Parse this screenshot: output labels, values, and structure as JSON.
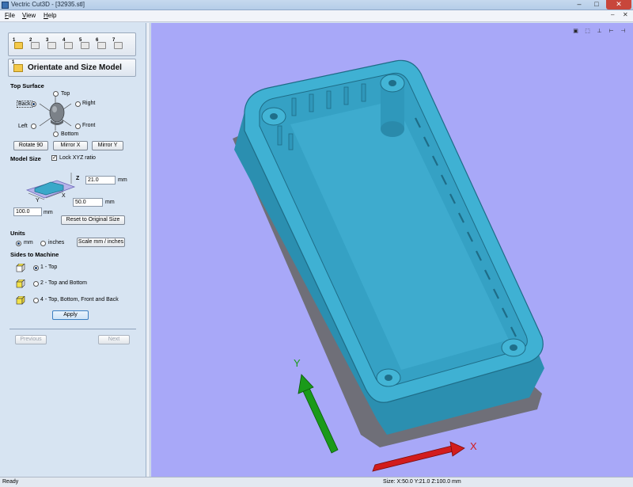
{
  "window": {
    "title": "Vectric Cut3D - [32935.stl]",
    "minimize_glyph": "–",
    "maximize_glyph": "□",
    "close_glyph": "✕"
  },
  "menu": {
    "items": [
      "File",
      "View",
      "Help"
    ],
    "mdi_minimize": "–",
    "mdi_close": "✕"
  },
  "steps": [
    {
      "number": "1",
      "icon": "folder-open-icon"
    },
    {
      "number": "2",
      "icon": "orientate-icon"
    },
    {
      "number": "3",
      "icon": "material-icon"
    },
    {
      "number": "4",
      "icon": "roughing-icon"
    },
    {
      "number": "5",
      "icon": "finishing-icon"
    },
    {
      "number": "6",
      "icon": "cutout-icon"
    },
    {
      "number": "7",
      "icon": "save-toolpath-icon"
    }
  ],
  "panel": {
    "heading_number": "1",
    "heading": "Orientate and Size Model",
    "top_surface": {
      "label": "Top Surface",
      "top": "Top",
      "back": "Back",
      "right": "Right",
      "left": "Left",
      "front": "Front",
      "bottom": "Bottom",
      "selected": "Back"
    },
    "buttons": {
      "rotate": "Rotate 90",
      "mirror_x": "Mirror X",
      "mirror_y": "Mirror Y"
    },
    "model_size": {
      "label": "Model Size",
      "lock_label": "Lock XYZ ratio",
      "lock_checked": true,
      "z_value": "21.0",
      "z_unit": "mm",
      "x_value": "50.0",
      "x_unit": "mm",
      "y_value": "100.0",
      "y_unit": "mm",
      "axis_z": "Z",
      "axis_x": "X",
      "axis_y": "Y",
      "reset_label": "Reset to Original Size"
    },
    "units": {
      "label": "Units",
      "mm": "mm",
      "inches": "inches",
      "selected": "mm",
      "scale_label": "Scale mm / inches"
    },
    "sides": {
      "label": "Sides to Machine",
      "options": [
        "1 - Top",
        "2 - Top and Bottom",
        "4 - Top, Bottom, Front and Back"
      ],
      "selected": "1 - Top"
    },
    "apply_label": "Apply",
    "previous_label": "Previous",
    "next_label": "Next"
  },
  "viewport": {
    "background": "#a8a8f8",
    "model_color": "#3aa8c9",
    "axis_x_label": "X",
    "axis_y_label": "Y",
    "view_icons": [
      "zoom-extents-icon",
      "iso-view-icon",
      "top-view-icon",
      "front-view-icon",
      "side-view-icon"
    ]
  },
  "status": {
    "left": "Ready",
    "size": "Size: X:50.0 Y:21.0 Z:100.0 mm"
  }
}
